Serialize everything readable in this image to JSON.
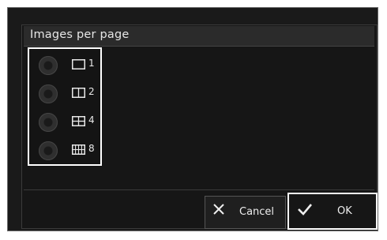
{
  "dialog": {
    "title": "Images per page"
  },
  "options": [
    {
      "label": "1",
      "icon": "layout-1-icon"
    },
    {
      "label": "2",
      "icon": "layout-2-icon"
    },
    {
      "label": "4",
      "icon": "layout-4-icon"
    },
    {
      "label": "8",
      "icon": "layout-8-icon"
    }
  ],
  "buttons": {
    "cancel_label": "Cancel",
    "ok_label": "OK"
  },
  "colors": {
    "background": "#161616",
    "text": "#e6e6e6",
    "highlight": "#ffffff"
  }
}
